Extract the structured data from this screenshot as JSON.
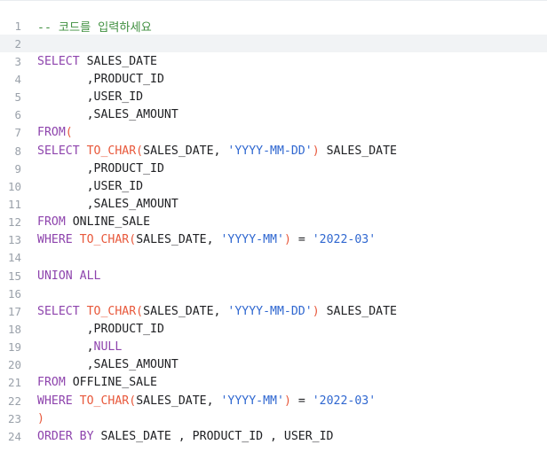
{
  "editor": {
    "lines": [
      {
        "num": "1",
        "tokens": [
          {
            "t": "-- 코드를 입력하세요",
            "c": "cm"
          }
        ]
      },
      {
        "num": "2",
        "tokens": [],
        "active": true
      },
      {
        "num": "3",
        "tokens": [
          {
            "t": "SELECT",
            "c": "kw"
          },
          {
            "t": " SALES_DATE",
            "c": "pl"
          }
        ]
      },
      {
        "num": "4",
        "tokens": [
          {
            "t": "       ,PRODUCT_ID",
            "c": "pl"
          }
        ]
      },
      {
        "num": "5",
        "tokens": [
          {
            "t": "       ,USER_ID",
            "c": "pl"
          }
        ]
      },
      {
        "num": "6",
        "tokens": [
          {
            "t": "       ,SALES_AMOUNT",
            "c": "pl"
          }
        ]
      },
      {
        "num": "7",
        "tokens": [
          {
            "t": "FROM",
            "c": "kw"
          },
          {
            "t": "(",
            "c": "fn"
          }
        ]
      },
      {
        "num": "8",
        "tokens": [
          {
            "t": "SELECT",
            "c": "kw"
          },
          {
            "t": " ",
            "c": "pl"
          },
          {
            "t": "TO_CHAR(",
            "c": "fn"
          },
          {
            "t": "SALES_DATE, ",
            "c": "pl"
          },
          {
            "t": "'YYYY-MM-DD'",
            "c": "str"
          },
          {
            "t": ")",
            "c": "fn"
          },
          {
            "t": " SALES_DATE",
            "c": "pl"
          }
        ]
      },
      {
        "num": "9",
        "tokens": [
          {
            "t": "       ,PRODUCT_ID",
            "c": "pl"
          }
        ]
      },
      {
        "num": "10",
        "tokens": [
          {
            "t": "       ,USER_ID",
            "c": "pl"
          }
        ]
      },
      {
        "num": "11",
        "tokens": [
          {
            "t": "       ,SALES_AMOUNT",
            "c": "pl"
          }
        ]
      },
      {
        "num": "12",
        "tokens": [
          {
            "t": "FROM",
            "c": "kw"
          },
          {
            "t": " ONLINE_SALE",
            "c": "pl"
          }
        ]
      },
      {
        "num": "13",
        "tokens": [
          {
            "t": "WHERE",
            "c": "kw"
          },
          {
            "t": " ",
            "c": "pl"
          },
          {
            "t": "TO_CHAR(",
            "c": "fn"
          },
          {
            "t": "SALES_DATE, ",
            "c": "pl"
          },
          {
            "t": "'YYYY-MM'",
            "c": "str"
          },
          {
            "t": ")",
            "c": "fn"
          },
          {
            "t": " = ",
            "c": "pl"
          },
          {
            "t": "'2022-03'",
            "c": "str"
          }
        ]
      },
      {
        "num": "14",
        "tokens": []
      },
      {
        "num": "15",
        "tokens": [
          {
            "t": "UNION ALL",
            "c": "kw"
          }
        ]
      },
      {
        "num": "16",
        "tokens": []
      },
      {
        "num": "17",
        "tokens": [
          {
            "t": "SELECT",
            "c": "kw"
          },
          {
            "t": " ",
            "c": "pl"
          },
          {
            "t": "TO_CHAR(",
            "c": "fn"
          },
          {
            "t": "SALES_DATE, ",
            "c": "pl"
          },
          {
            "t": "'YYYY-MM-DD'",
            "c": "str"
          },
          {
            "t": ")",
            "c": "fn"
          },
          {
            "t": " SALES_DATE",
            "c": "pl"
          }
        ]
      },
      {
        "num": "18",
        "tokens": [
          {
            "t": "       ,PRODUCT_ID",
            "c": "pl"
          }
        ]
      },
      {
        "num": "19",
        "tokens": [
          {
            "t": "       ,",
            "c": "pl"
          },
          {
            "t": "NULL",
            "c": "kw"
          }
        ]
      },
      {
        "num": "20",
        "tokens": [
          {
            "t": "       ,SALES_AMOUNT",
            "c": "pl"
          }
        ]
      },
      {
        "num": "21",
        "tokens": [
          {
            "t": "FROM",
            "c": "kw"
          },
          {
            "t": " OFFLINE_SALE",
            "c": "pl"
          }
        ]
      },
      {
        "num": "22",
        "tokens": [
          {
            "t": "WHERE",
            "c": "kw"
          },
          {
            "t": " ",
            "c": "pl"
          },
          {
            "t": "TO_CHAR(",
            "c": "fn"
          },
          {
            "t": "SALES_DATE, ",
            "c": "pl"
          },
          {
            "t": "'YYYY-MM'",
            "c": "str"
          },
          {
            "t": ")",
            "c": "fn"
          },
          {
            "t": " = ",
            "c": "pl"
          },
          {
            "t": "'2022-03'",
            "c": "str"
          }
        ]
      },
      {
        "num": "23",
        "tokens": [
          {
            "t": ")",
            "c": "fn"
          }
        ]
      },
      {
        "num": "24",
        "tokens": [
          {
            "t": "ORDER BY",
            "c": "kw"
          },
          {
            "t": " SALES_DATE , PRODUCT_ID , USER_ID",
            "c": "pl"
          }
        ]
      }
    ]
  },
  "colors": {
    "keyword": "#8e44ad",
    "function": "#e8593c",
    "string": "#2f67d0",
    "comment": "#3f8f3f",
    "plain": "#202124",
    "gutter": "#9aa1aa",
    "active_line": "#f1f3f5"
  }
}
